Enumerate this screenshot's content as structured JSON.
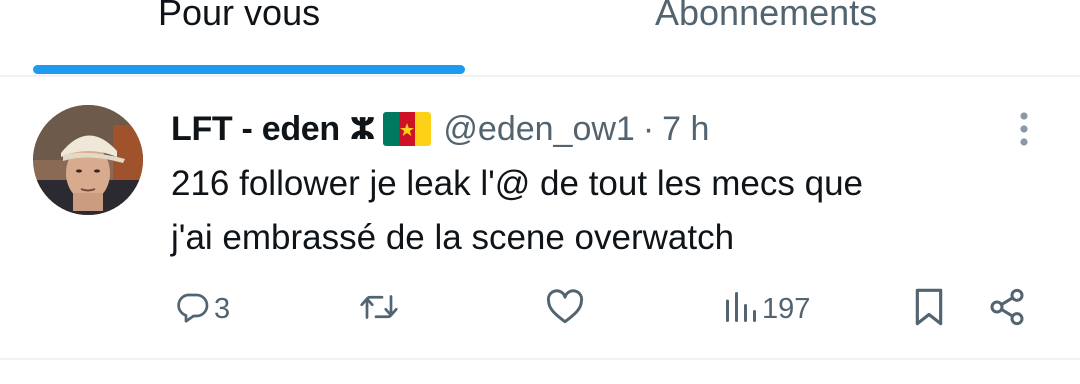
{
  "tabs": {
    "for_you": "Pour vous",
    "following": "Abonnements",
    "accent_color": "#1d9bf0"
  },
  "tweet": {
    "display_name": "LFT - eden",
    "name_glyph": "ⵣ",
    "flag_icon": "cameroon-flag-icon",
    "handle": "@eden_ow1",
    "separator": "·",
    "time": "7 h",
    "text_line_1": "216 follower je leak l'@ de tout les mecs que",
    "text_line_2": "j'ai embrassé de la scene overwatch",
    "actions": {
      "reply_count": "3",
      "views_count": "197"
    },
    "icons": {
      "more": "more-vertical-icon",
      "reply": "reply-icon",
      "retweet": "retweet-icon",
      "like": "heart-icon",
      "views": "views-icon",
      "bookmark": "bookmark-icon",
      "share": "share-icon"
    }
  }
}
